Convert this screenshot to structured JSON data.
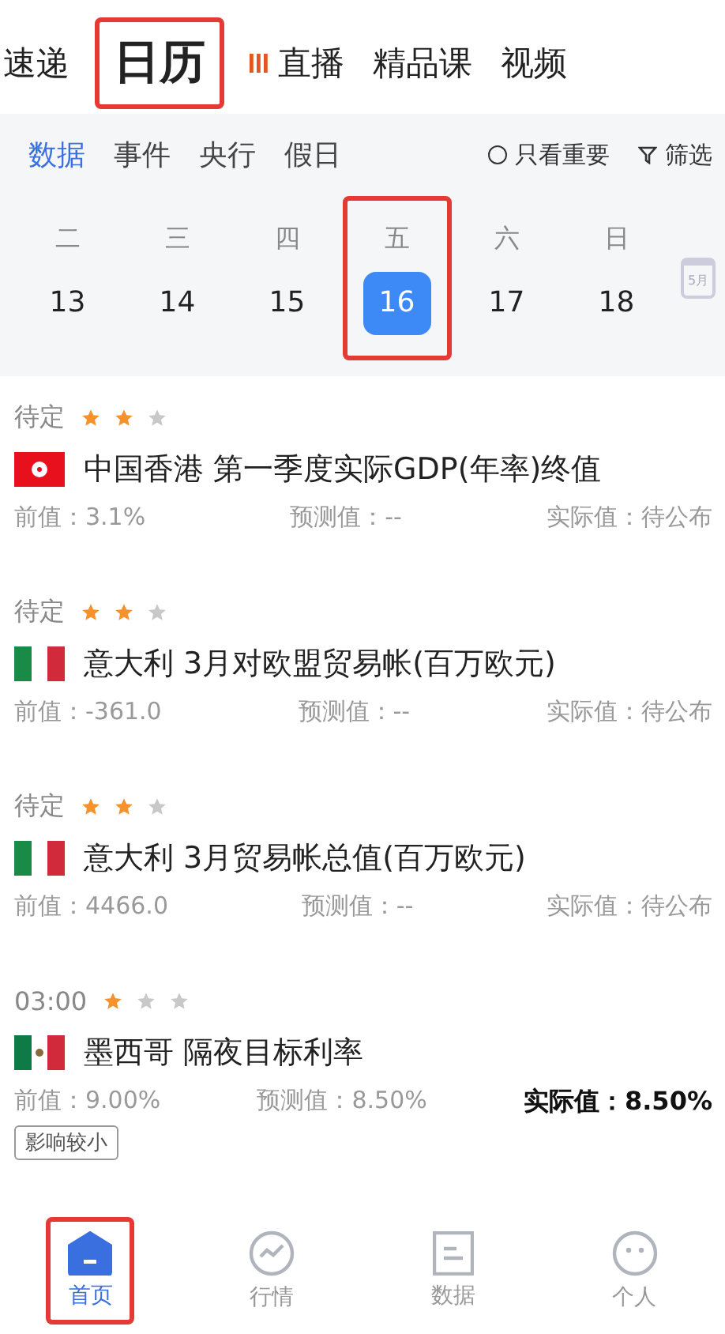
{
  "top_tabs": [
    {
      "label": "速递",
      "selected": false,
      "live": false,
      "highlighted": false
    },
    {
      "label": "日历",
      "selected": true,
      "live": false,
      "highlighted": true
    },
    {
      "label": "直播",
      "selected": false,
      "live": true,
      "highlighted": false
    },
    {
      "label": "精品课",
      "selected": false,
      "live": false,
      "highlighted": false
    },
    {
      "label": "视频",
      "selected": false,
      "live": false,
      "highlighted": false
    }
  ],
  "sub_tabs": [
    {
      "label": "数据",
      "selected": true
    },
    {
      "label": "事件",
      "selected": false
    },
    {
      "label": "央行",
      "selected": false
    },
    {
      "label": "假日",
      "selected": false
    }
  ],
  "important_only": {
    "label": "只看重要",
    "checked": false
  },
  "filter": {
    "label": "筛选"
  },
  "week": [
    {
      "weekday": "二",
      "date": "13",
      "selected": false,
      "highlighted": false
    },
    {
      "weekday": "三",
      "date": "14",
      "selected": false,
      "highlighted": false
    },
    {
      "weekday": "四",
      "date": "15",
      "selected": false,
      "highlighted": false
    },
    {
      "weekday": "五",
      "date": "16",
      "selected": true,
      "highlighted": true
    },
    {
      "weekday": "六",
      "date": "17",
      "selected": false,
      "highlighted": false
    },
    {
      "weekday": "日",
      "date": "18",
      "selected": false,
      "highlighted": false
    }
  ],
  "month_button": "5月",
  "events": [
    {
      "time": "待定",
      "stars": 2,
      "kind": "hk",
      "title": "中国香港 第一季度实际GDP(年率)终值",
      "previous": "前值：3.1%",
      "forecast": "预测值：--",
      "actual": "实际值：待公布",
      "actual_released": false
    },
    {
      "time": "待定",
      "stars": 2,
      "kind": "it",
      "title": "意大利 3月对欧盟贸易帐(百万欧元)",
      "previous": "前值：-361.0",
      "forecast": "预测值：--",
      "actual": "实际值：待公布",
      "actual_released": false
    },
    {
      "time": "待定",
      "stars": 2,
      "kind": "it",
      "title": "意大利 3月贸易帐总值(百万欧元)",
      "previous": "前值：4466.0",
      "forecast": "预测值：--",
      "actual": "实际值：待公布",
      "actual_released": false
    },
    {
      "time": "03:00",
      "stars": 1,
      "kind": "mx",
      "title": "墨西哥 隔夜目标利率",
      "previous": "前值：9.00%",
      "forecast": "预测值：8.50%",
      "actual": "实际值：8.50%",
      "actual_released": true,
      "impact": "影响较小"
    }
  ],
  "bottom_nav": [
    {
      "label": "首页",
      "kind": "home",
      "selected": true,
      "highlighted": true
    },
    {
      "label": "行情",
      "kind": "chart",
      "selected": false,
      "highlighted": false
    },
    {
      "label": "数据",
      "kind": "doc",
      "selected": false,
      "highlighted": false
    },
    {
      "label": "个人",
      "kind": "face",
      "selected": false,
      "highlighted": false
    }
  ]
}
